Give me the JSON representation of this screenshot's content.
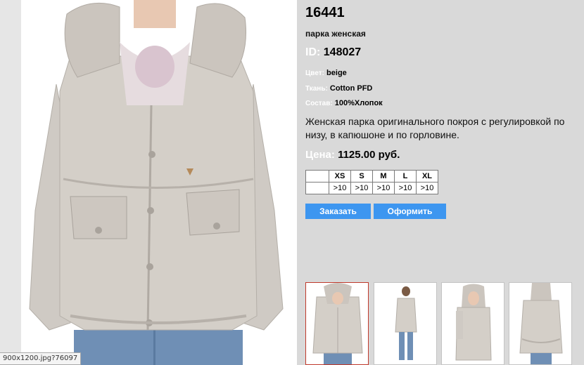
{
  "product": {
    "sku": "16441",
    "type": "парка женская",
    "id_label": "ID:",
    "id_value": "148027",
    "color_label": "Цвет:",
    "color_value": "beige",
    "fabric_label": "Ткань:",
    "fabric_value": "Cotton PFD",
    "composition_label": "Состав:",
    "composition_value": "100%Хлопок",
    "description": "Женская парка оригинального покроя с регулировкой по низу, в капюшоне и по горловине.",
    "price_label": "Цена:",
    "price_value": "1125.00 руб."
  },
  "sizes": {
    "headers": [
      "XS",
      "S",
      "M",
      "L",
      "XL"
    ],
    "quantities": [
      ">10",
      ">10",
      ">10",
      ">10",
      ">10"
    ]
  },
  "buttons": {
    "order": "Заказать",
    "checkout": "Оформить"
  },
  "status_tooltip": "900x1200.jpg?76097",
  "colors": {
    "background": "#d9d9d9",
    "button": "#3d96f0",
    "label": "#ffffff",
    "active_thumb_border": "#c0392b"
  }
}
